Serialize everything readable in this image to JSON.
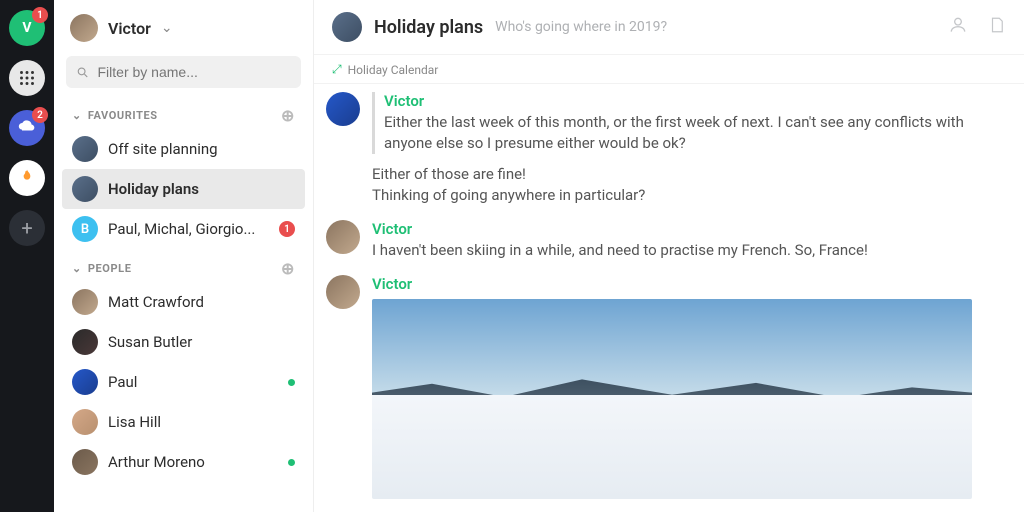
{
  "rail": {
    "items": [
      {
        "letter": "V",
        "bg": "#1fbf75",
        "badge": "1"
      },
      {
        "letter": "",
        "bg": "#e8e8e8",
        "badge": ""
      },
      {
        "letter": "",
        "bg": "#4a5fd8",
        "badge": "2"
      },
      {
        "letter": "",
        "bg": "#ff9a2e",
        "badge": ""
      },
      {
        "letter": "+",
        "bg": "#2b2f36",
        "badge": ""
      }
    ]
  },
  "sidebar": {
    "workspace_name": "Victor",
    "search_placeholder": "Filter by name...",
    "sections": {
      "favourites": {
        "label": "FAVOURITES",
        "items": [
          {
            "label": "Off site planning",
            "avatar": "avcol2"
          },
          {
            "label": "Holiday plans",
            "avatar": "avcol2",
            "active": true
          },
          {
            "label": "Paul, Michal, Giorgio...",
            "avatar_letter": "B",
            "badge": "1"
          }
        ]
      },
      "people": {
        "label": "PEOPLE",
        "items": [
          {
            "label": "Matt Crawford",
            "avatar": "avcol1"
          },
          {
            "label": "Susan Butler",
            "avatar": "avcol3"
          },
          {
            "label": "Paul",
            "avatar": "avcol4",
            "online": true
          },
          {
            "label": "Lisa Hill",
            "avatar": "avcol5"
          },
          {
            "label": "Arthur Moreno",
            "avatar": "avcol6",
            "online": true
          }
        ]
      }
    }
  },
  "header": {
    "title": "Holiday plans",
    "subtitle": "Who's going where in 2019?"
  },
  "widget": {
    "label": "Holiday Calendar"
  },
  "thread": {
    "messages": [
      {
        "author": "Victor",
        "quoted": true,
        "text": "Either the last week of this month, or the first week of next. I can't see any conflicts with anyone else so I presume either would be ok?",
        "avatar": "avcol4"
      },
      {
        "author": "",
        "text": "Either of those are fine!",
        "continuation": true
      },
      {
        "author": "",
        "text": "Thinking of going anywhere in particular?",
        "continuation": true
      },
      {
        "author": "Victor",
        "text": "I haven't been skiing in a while, and need to practise my French. So, France!",
        "avatar": "avcol1"
      },
      {
        "author": "Victor",
        "text": "",
        "image": true,
        "avatar": "avcol1"
      }
    ]
  }
}
